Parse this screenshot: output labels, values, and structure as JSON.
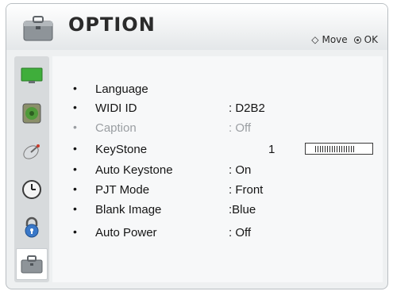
{
  "header": {
    "title": "OPTION",
    "hint_move": "Move",
    "hint_ok": "OK"
  },
  "sidebar": {
    "items": [
      {
        "icon": "picture-icon",
        "active": false
      },
      {
        "icon": "audio-icon",
        "active": false
      },
      {
        "icon": "satellite-icon",
        "active": false
      },
      {
        "icon": "time-icon",
        "active": false
      },
      {
        "icon": "lock-icon",
        "active": false
      },
      {
        "icon": "option-toolbox-icon",
        "active": true
      }
    ]
  },
  "menu": {
    "items": [
      {
        "label": "Language",
        "value": ""
      },
      {
        "label": "WIDI ID",
        "value": ": D2B2"
      },
      {
        "label": "Caption",
        "value": ": Off",
        "disabled": true
      },
      {
        "label": "KeyStone",
        "value": "1",
        "slider_level": 0.8
      },
      {
        "label": "Auto Keystone",
        "value": ": On"
      },
      {
        "label": "PJT Mode",
        "value": ": Front"
      },
      {
        "label": "Blank Image",
        "value": ":Blue"
      },
      {
        "label": "Auto Power",
        "value": ": Off"
      }
    ]
  },
  "colors": {
    "panel_bg": "#eef0f1",
    "text": "#151515",
    "disabled_text": "#9a9ea2"
  }
}
